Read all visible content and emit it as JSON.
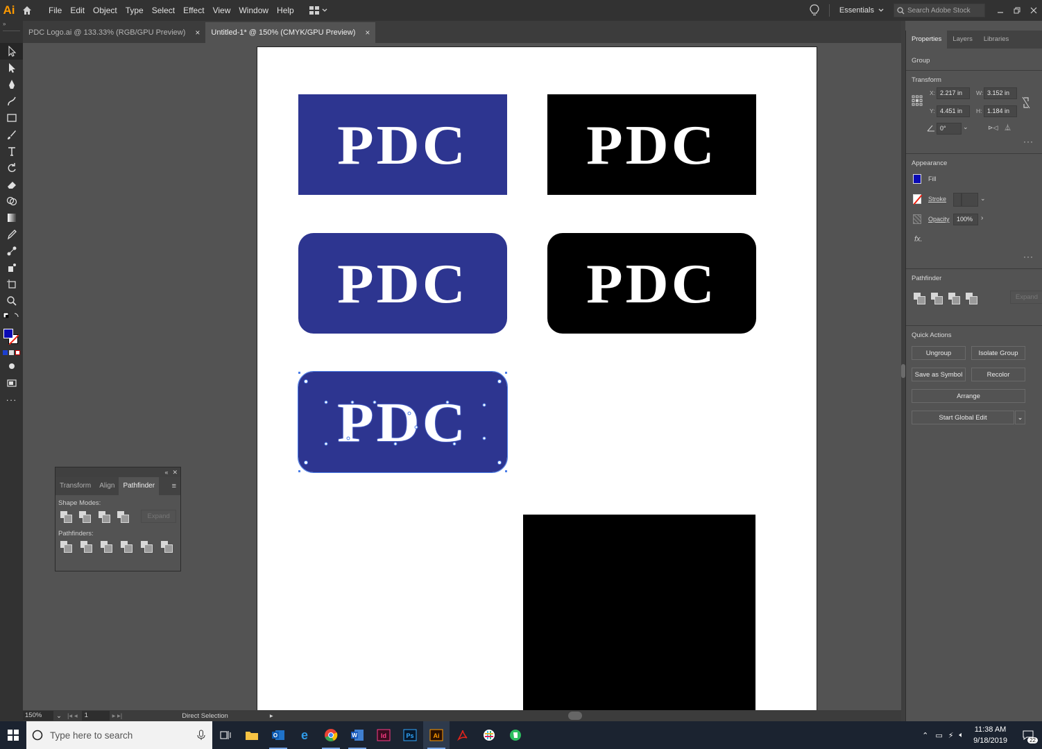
{
  "app": {
    "logo": "Ai"
  },
  "menus": [
    "File",
    "Edit",
    "Object",
    "Type",
    "Select",
    "Effect",
    "View",
    "Window",
    "Help"
  ],
  "workspace": {
    "name": "Essentials"
  },
  "search_stock": {
    "placeholder": "Search Adobe Stock"
  },
  "tabs": [
    {
      "label": "PDC Logo.ai @ 133.33% (RGB/GPU Preview)",
      "close": "×",
      "active": false
    },
    {
      "label": "Untitled-1* @ 150% (CMYK/GPU Preview)",
      "close": "×",
      "active": true
    }
  ],
  "artboard": {
    "logo_text": "PDC",
    "colors": {
      "blue": "#2d3590",
      "black": "#000000",
      "selection": "#4d7fe8"
    }
  },
  "float_panel": {
    "tabs": [
      "Transform",
      "Align",
      "Pathfinder"
    ],
    "shape_modes_label": "Shape Modes:",
    "pathfinders_label": "Pathfinders:",
    "expand_label": "Expand"
  },
  "status": {
    "zoom": "150%",
    "page": "1",
    "tool": "Direct Selection"
  },
  "properties": {
    "tabs": [
      "Properties",
      "Layers",
      "Libraries"
    ],
    "selection_type": "Group",
    "transform_label": "Transform",
    "x_label": "X:",
    "x": "2.217 in",
    "w_label": "W:",
    "w": "3.152 in",
    "y_label": "Y:",
    "y": "4.451 in",
    "h_label": "H:",
    "h": "1.184 in",
    "rotate": "0°",
    "appearance_label": "Appearance",
    "fill_label": "Fill",
    "fill_color": "#0a0ab4",
    "stroke_label": "Stroke",
    "opacity_label": "Opacity",
    "opacity": "100%",
    "fx_label": "fx.",
    "pathfinder_label": "Pathfinder",
    "expand_label": "Expand",
    "quick_actions_label": "Quick Actions",
    "ungroup": "Ungroup",
    "isolate_group": "Isolate Group",
    "save_as_symbol": "Save as Symbol",
    "recolor": "Recolor",
    "arrange": "Arrange",
    "start_global_edit": "Start Global Edit"
  },
  "taskbar": {
    "search_placeholder": "Type here to search",
    "time": "11:38 AM",
    "date": "9/18/2019",
    "notifications": "22"
  }
}
